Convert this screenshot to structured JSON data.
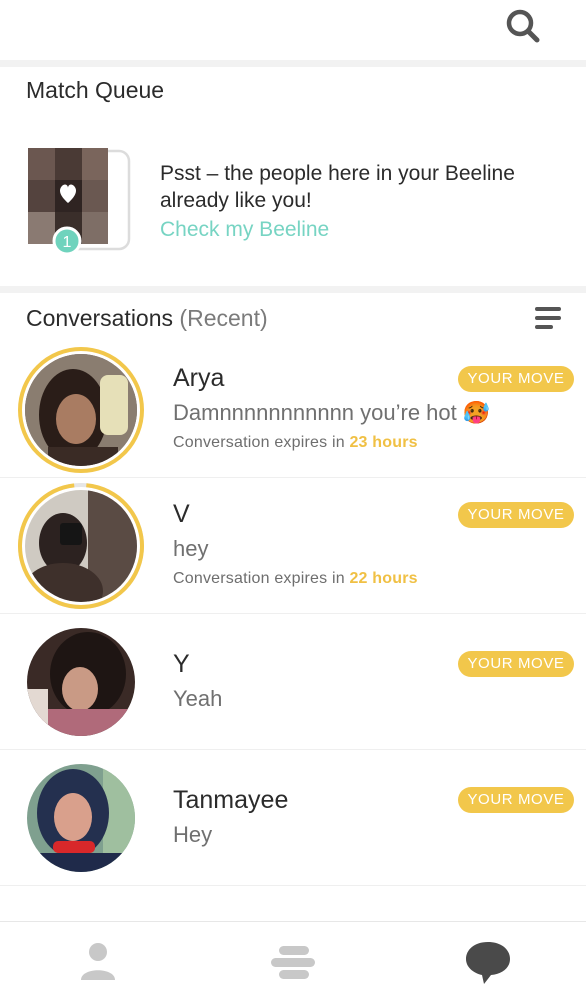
{
  "icons": {
    "search": "search-icon",
    "sort_menu": "menu-lines-icon",
    "heart": "heart-icon",
    "profile": "person-icon",
    "discover": "stacked-bars-icon",
    "chat": "chat-bubble-icon"
  },
  "colors": {
    "accent_yellow": "#f2c74b",
    "teal_link": "#77d4c3",
    "hours_text": "#f0c044",
    "nav_icon": "#c8c8c8",
    "nav_active": "#4a4a4a"
  },
  "match_queue": {
    "title": "Match Queue",
    "count": "1",
    "message": "Psst – the people here in your Beeline already like you!",
    "link": "Check my Beeline"
  },
  "conversations": {
    "title": "Conversations",
    "filter": "(Recent)",
    "items": [
      {
        "name": "Arya",
        "message": "Damnnnnnnnnnnn you’re hot 🥵",
        "expiry_prefix": "Conversation expires in",
        "expiry_hours": "23 hours",
        "badge": "YOUR MOVE",
        "ring_progress": 1.0
      },
      {
        "name": "V",
        "message": "hey",
        "expiry_prefix": "Conversation expires in",
        "expiry_hours": "22 hours",
        "badge": "YOUR MOVE",
        "ring_progress": 0.97
      },
      {
        "name": "Y",
        "message": "Yeah",
        "badge": "YOUR MOVE"
      },
      {
        "name": "Tanmayee",
        "message": "Hey",
        "badge": "YOUR MOVE"
      }
    ]
  }
}
